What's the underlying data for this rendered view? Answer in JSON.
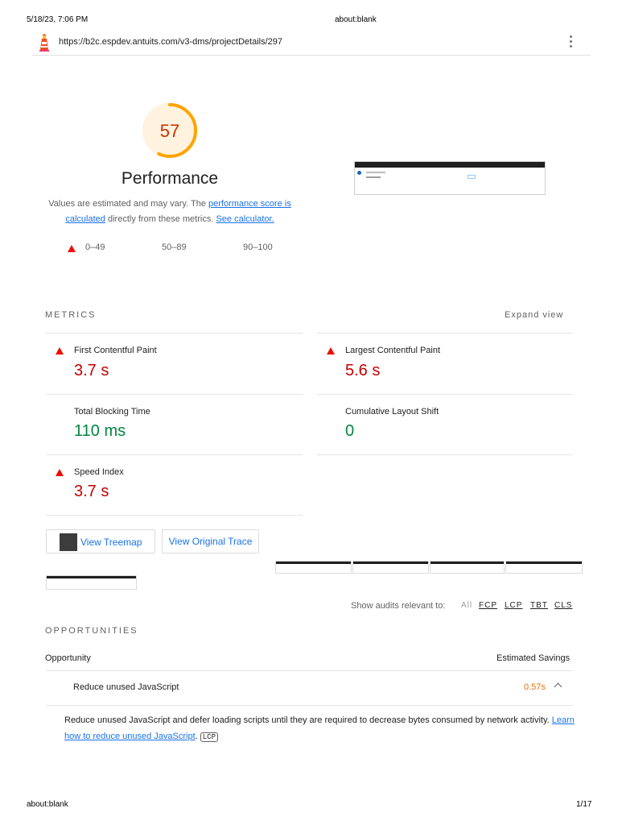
{
  "print_header": {
    "datetime": "5/18/23, 7:06 PM",
    "title": "about:blank"
  },
  "print_footer": {
    "left": "about:blank",
    "page": "1/17"
  },
  "url_bar": {
    "url": "https://b2c.espdev.antuits.com/v3-dms/projectDetails/297",
    "icon": "lighthouse-icon",
    "menu_icon": "kebab-menu-icon"
  },
  "gauge": {
    "score": "57",
    "score_value": 57,
    "color": "#ffa400",
    "label": "Performance"
  },
  "description": {
    "prefix": "Values are estimated and may vary. The ",
    "link1": "performance score is calculated",
    "middle": " directly from these metrics. ",
    "link2": "See calculator."
  },
  "legend": [
    {
      "range": "0–49",
      "icon": "fail-triangle-icon",
      "color": "#eb0f00"
    },
    {
      "range": "50–89",
      "icon": "average-square-icon",
      "color": "#ffa400"
    },
    {
      "range": "90–100",
      "icon": "pass-circle-icon",
      "color": "#0cce6b"
    }
  ],
  "metrics": {
    "title": "METRICS",
    "expand": "Expand view",
    "items": [
      {
        "label": "First Contentful Paint",
        "value": "3.7 s",
        "status": "fail"
      },
      {
        "label": "Largest Contentful Paint",
        "value": "5.6 s",
        "status": "fail"
      },
      {
        "label": "Total Blocking Time",
        "value": "110 ms",
        "status": "pass"
      },
      {
        "label": "Cumulative Layout Shift",
        "value": "0",
        "status": "pass"
      },
      {
        "label": "Speed Index",
        "value": "3.7 s",
        "status": "fail"
      }
    ]
  },
  "buttons": {
    "treemap": "View Treemap",
    "trace": "View Original Trace"
  },
  "filter": {
    "label": "Show audits relevant to:",
    "chips": [
      "All",
      "FCP",
      "LCP",
      "TBT",
      "CLS"
    ]
  },
  "opportunities": {
    "title": "OPPORTUNITIES",
    "col_opportunity": "Opportunity",
    "col_savings": "Estimated Savings",
    "audit": {
      "title": "Reduce unused JavaScript",
      "savings": "0.57s",
      "description": "Reduce unused JavaScript and defer loading scripts until they are required to decrease bytes consumed by network activity. ",
      "link": "Learn how to reduce unused JavaScript",
      "after_link": ".",
      "tag": "LCP"
    }
  }
}
